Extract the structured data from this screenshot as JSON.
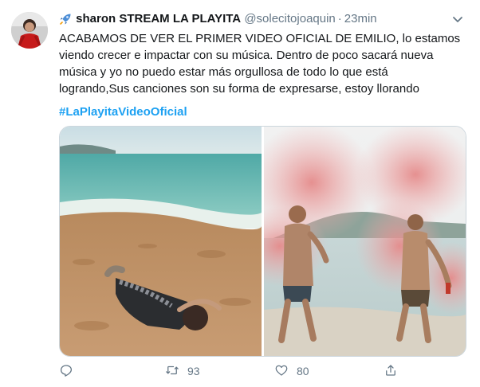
{
  "tweet": {
    "display_name": "sharon STREAM LA PLAYITA",
    "display_name_emoji": "rocket",
    "handle": "@solecitojoaquin",
    "separator": "·",
    "time": "23min",
    "text": "ACABAMOS DE VER EL PRIMER VIDEO OFICIAL DE EMILIO, lo estamos viendo crecer e impactar con su música. Dentro de poco sacará nueva música y yo no puedo estar más orgullosa de todo lo que está logrando,Sus canciones son su forma de expresarse, estoy llorando",
    "hashtag": "#LaPlayitaVideoOficial",
    "media": [
      {
        "description": "person lying on sandy beach by the sea"
      },
      {
        "description": "two people with pink smoke flares in shallow water"
      }
    ],
    "actions": {
      "reply": {
        "icon": "reply-icon",
        "count": ""
      },
      "retweet": {
        "icon": "retweet-icon",
        "count": "93"
      },
      "like": {
        "icon": "heart-icon",
        "count": "80"
      },
      "share": {
        "icon": "share-icon",
        "count": ""
      }
    }
  },
  "colors": {
    "link": "#1da1f2",
    "secondary_text": "#657786",
    "border": "#ccd6dd",
    "rocket": "#4d8ed6"
  }
}
